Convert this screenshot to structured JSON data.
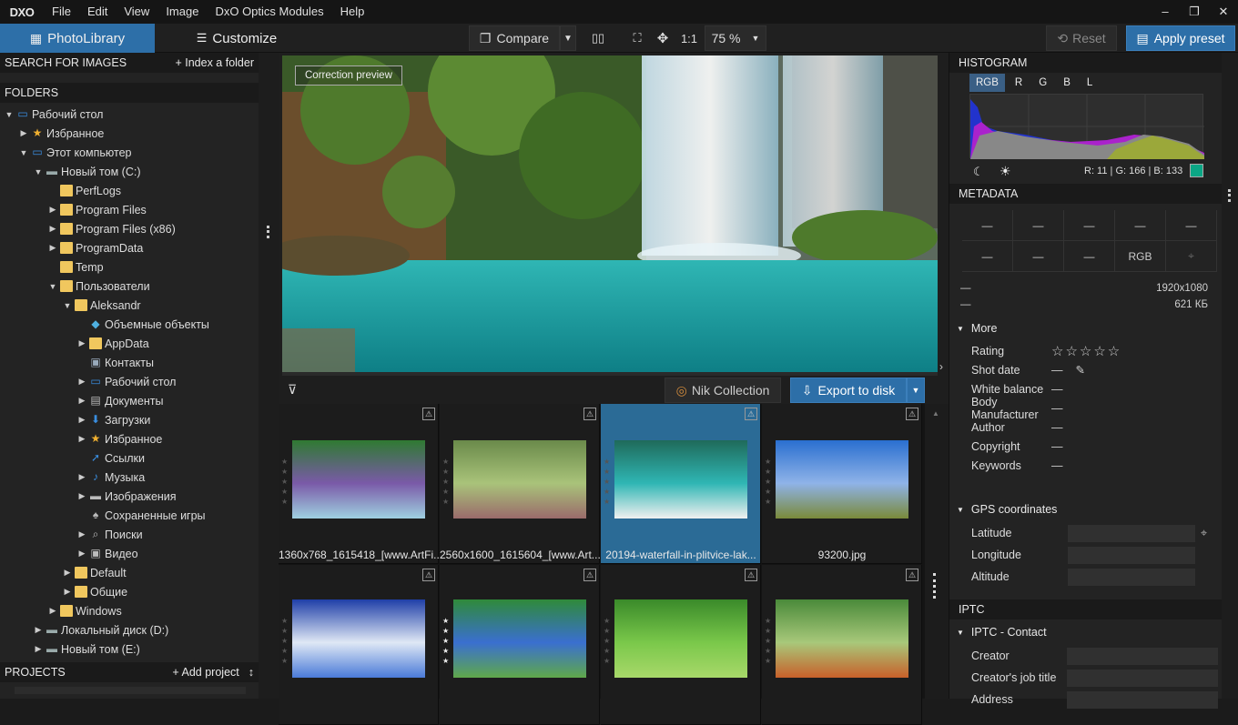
{
  "app": {
    "logo": "DXO"
  },
  "menu": [
    "File",
    "Edit",
    "View",
    "Image",
    "DxO Optics Modules",
    "Help"
  ],
  "window_controls": {
    "minimize": "–",
    "restore": "❐",
    "close": "✕"
  },
  "toolbar": {
    "tab_library": "PhotoLibrary",
    "tab_customize": "Customize",
    "compare": "Compare",
    "zoom_1to1": "1:1",
    "zoom": "75 %",
    "reset": "Reset",
    "apply_preset": "Apply preset"
  },
  "left": {
    "search_header": "SEARCH FOR IMAGES",
    "index_folder": "+ Index a folder",
    "folders_header": "FOLDERS",
    "tree": [
      {
        "label": "Рабочий стол",
        "depth": 0,
        "tw": "▼",
        "icon": "desktop"
      },
      {
        "label": "Избранное",
        "depth": 1,
        "tw": "▶",
        "icon": "star"
      },
      {
        "label": "Этот компьютер",
        "depth": 1,
        "tw": "▼",
        "icon": "computer"
      },
      {
        "label": "Новый том (C:)",
        "depth": 2,
        "tw": "▼",
        "icon": "drive"
      },
      {
        "label": "PerfLogs",
        "depth": 3,
        "tw": "",
        "icon": "folder"
      },
      {
        "label": "Program Files",
        "depth": 3,
        "tw": "▶",
        "icon": "folder"
      },
      {
        "label": "Program Files (x86)",
        "depth": 3,
        "tw": "▶",
        "icon": "folder"
      },
      {
        "label": "ProgramData",
        "depth": 3,
        "tw": "▶",
        "icon": "folder"
      },
      {
        "label": "Temp",
        "depth": 3,
        "tw": "",
        "icon": "folder"
      },
      {
        "label": "Пользователи",
        "depth": 3,
        "tw": "▼",
        "icon": "folder"
      },
      {
        "label": "Aleksandr",
        "depth": 4,
        "tw": "▼",
        "icon": "folder"
      },
      {
        "label": "Объемные объекты",
        "depth": 5,
        "tw": "",
        "icon": "cube"
      },
      {
        "label": "AppData",
        "depth": 5,
        "tw": "▶",
        "icon": "folder"
      },
      {
        "label": "Контакты",
        "depth": 5,
        "tw": "",
        "icon": "contacts"
      },
      {
        "label": "Рабочий стол",
        "depth": 5,
        "tw": "▶",
        "icon": "desktop"
      },
      {
        "label": "Документы",
        "depth": 5,
        "tw": "▶",
        "icon": "documents"
      },
      {
        "label": "Загрузки",
        "depth": 5,
        "tw": "▶",
        "icon": "download"
      },
      {
        "label": "Избранное",
        "depth": 5,
        "tw": "▶",
        "icon": "star"
      },
      {
        "label": "Ссылки",
        "depth": 5,
        "tw": "",
        "icon": "link"
      },
      {
        "label": "Музыка",
        "depth": 5,
        "tw": "▶",
        "icon": "music"
      },
      {
        "label": "Изображения",
        "depth": 5,
        "tw": "▶",
        "icon": "pictures"
      },
      {
        "label": "Сохраненные игры",
        "depth": 5,
        "tw": "",
        "icon": "games"
      },
      {
        "label": "Поиски",
        "depth": 5,
        "tw": "▶",
        "icon": "search"
      },
      {
        "label": "Видео",
        "depth": 5,
        "tw": "▶",
        "icon": "video"
      },
      {
        "label": "Default",
        "depth": 4,
        "tw": "▶",
        "icon": "folder"
      },
      {
        "label": "Общие",
        "depth": 4,
        "tw": "▶",
        "icon": "folder"
      },
      {
        "label": "Windows",
        "depth": 3,
        "tw": "▶",
        "icon": "folder"
      },
      {
        "label": "Локальный диск (D:)",
        "depth": 2,
        "tw": "▶",
        "icon": "drive"
      },
      {
        "label": "Новый том (E:)",
        "depth": 2,
        "tw": "▶",
        "icon": "drive"
      }
    ],
    "projects_header": "PROJECTS",
    "add_project": "+ Add project",
    "sort_glyph": "↕"
  },
  "center": {
    "correction_preview": "Correction preview",
    "nik_collection": "Nik Collection",
    "export": "Export to disk",
    "thumbnails": [
      {
        "name": "1360x768_1615418_[www.ArtFi...",
        "stars": 0,
        "selected": false
      },
      {
        "name": "2560x1600_1615604_[www.Art...",
        "stars": 0,
        "selected": false
      },
      {
        "name": "20194-waterfall-in-plitvice-lak...",
        "stars": 0,
        "selected": true
      },
      {
        "name": "93200.jpg",
        "stars": 0,
        "selected": false
      },
      {
        "name": "",
        "stars": 0,
        "selected": false
      },
      {
        "name": "",
        "stars": 4,
        "selected": false
      },
      {
        "name": "",
        "stars": 0,
        "selected": false
      },
      {
        "name": "",
        "stars": 0,
        "selected": false
      }
    ]
  },
  "right": {
    "histogram_header": "HISTOGRAM",
    "channels": [
      "RGB",
      "R",
      "G",
      "B",
      "L"
    ],
    "rgb_readout": "R:  11 | G: 166 | B: 133",
    "swatch_color": "#0ba685",
    "metadata_header": "METADATA",
    "meta_grid": [
      "—",
      "—",
      "—",
      "—",
      "—",
      "—",
      "—",
      "—",
      "RGB",
      ""
    ],
    "dim_left": "—",
    "dimensions": "1920x1080",
    "size_left": "—",
    "filesize": "621 КБ",
    "more_header": "More",
    "more": [
      {
        "k": "Rating",
        "v": "☆☆☆☆☆"
      },
      {
        "k": "Shot date",
        "v": "—"
      },
      {
        "k": "White balance",
        "v": "—"
      },
      {
        "k": "Body Manufacturer",
        "v": "—"
      },
      {
        "k": "Author",
        "v": "—"
      },
      {
        "k": "Copyright",
        "v": "—"
      },
      {
        "k": "Keywords",
        "v": "—"
      }
    ],
    "gps_header": "GPS coordinates",
    "gps": [
      "Latitude",
      "Longitude",
      "Altitude"
    ],
    "iptc_header": "IPTC",
    "iptc_contact": "IPTC - Contact",
    "iptc_fields": [
      "Creator",
      "Creator's job title",
      "Address"
    ]
  }
}
